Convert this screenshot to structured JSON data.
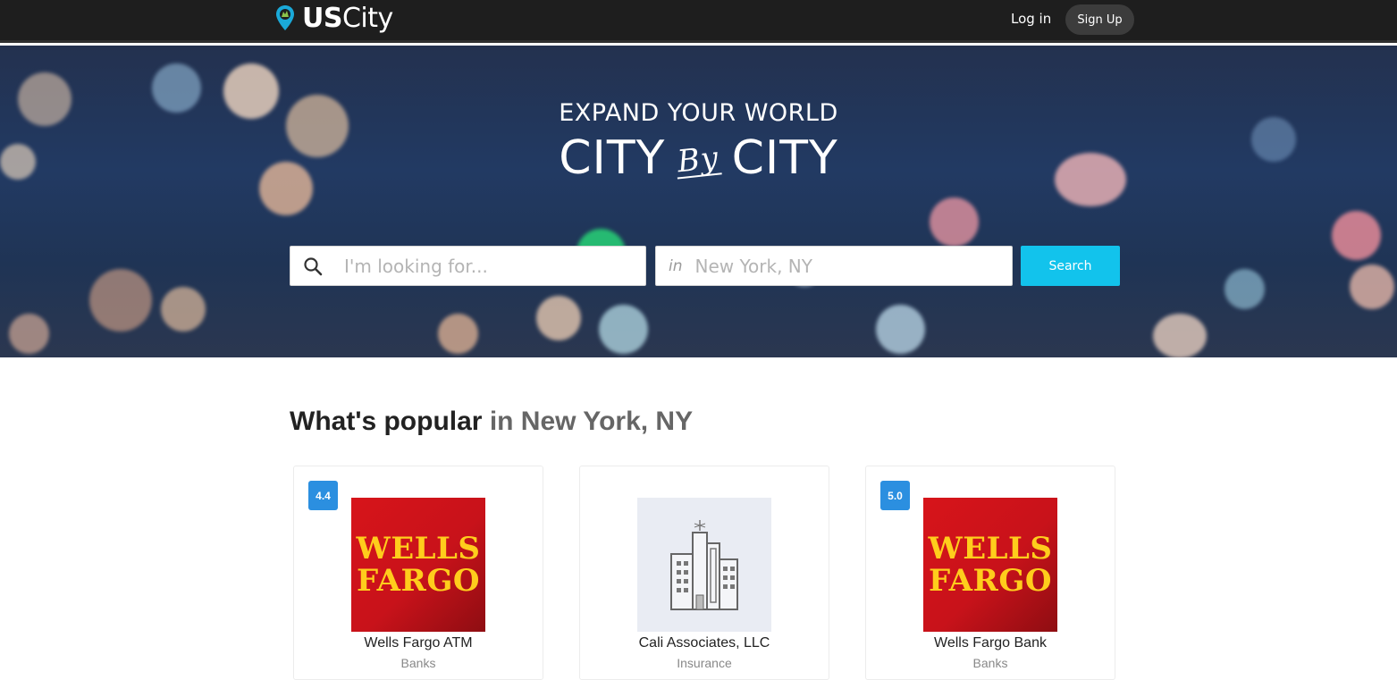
{
  "navbar": {
    "logo_bold": "US",
    "logo_light": "City",
    "login_label": "Log in",
    "signup_label": "Sign Up"
  },
  "hero": {
    "line1": "EXPAND YOUR WORLD",
    "line2_left": "CITY",
    "line2_by": "By",
    "line2_right": "CITY",
    "search_placeholder": "I'm looking for...",
    "location_prefix": "in",
    "location_placeholder": "New York, NY",
    "search_button": "Search"
  },
  "popular": {
    "title": "What's popular",
    "location": "in New York, NY",
    "cards": [
      {
        "rating": "4.4",
        "logo_line1": "WELLS",
        "logo_line2": "FARGO",
        "name": "Wells Fargo ATM",
        "category": "Banks"
      },
      {
        "rating": "",
        "name": "Cali Associates, LLC",
        "category": "Insurance"
      },
      {
        "rating": "5.0",
        "logo_line1": "WELLS",
        "logo_line2": "FARGO",
        "name": "Wells Fargo Bank",
        "category": "Banks"
      }
    ]
  },
  "colors": {
    "navbar_bg": "#1e1e1e",
    "search_button": "#12c3ec",
    "rating_badge": "#2b8fe0",
    "wells_fargo_red": "#d7141a",
    "wells_fargo_gold": "#ffcd1c"
  },
  "icons": {
    "logo": "map-pin-icon",
    "search": "search-icon",
    "building": "building-icon"
  }
}
